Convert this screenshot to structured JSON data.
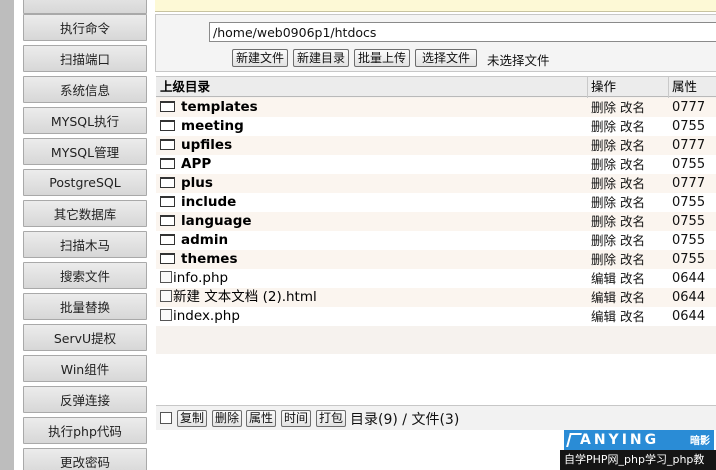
{
  "sidebar": {
    "items": [
      {
        "label": "执行命令"
      },
      {
        "label": "扫描端口"
      },
      {
        "label": "系统信息"
      },
      {
        "label": "MYSQL执行"
      },
      {
        "label": "MYSQL管理"
      },
      {
        "label": "PostgreSQL"
      },
      {
        "label": "其它数据库"
      },
      {
        "label": "扫描木马"
      },
      {
        "label": "搜索文件"
      },
      {
        "label": "批量替换"
      },
      {
        "label": "ServU提权"
      },
      {
        "label": "Win组件"
      },
      {
        "label": "反弹连接"
      },
      {
        "label": "执行php代码"
      },
      {
        "label": "更改密码"
      }
    ]
  },
  "path_bar": {
    "path": "/home/web0906p1/htdocs",
    "buttons": {
      "new_file": "新建文件",
      "new_dir": "新建目录",
      "batch_upload": "批量上传",
      "choose_file": "选择文件"
    },
    "no_file": "未选择文件"
  },
  "table": {
    "headers": {
      "name": "上级目录",
      "ops": "操作",
      "perm": "属性"
    },
    "dirs": [
      {
        "name": "templates",
        "op1": "删除",
        "op2": "改名",
        "perm": "0777"
      },
      {
        "name": "meeting",
        "op1": "删除",
        "op2": "改名",
        "perm": "0755"
      },
      {
        "name": "upfiles",
        "op1": "删除",
        "op2": "改名",
        "perm": "0777"
      },
      {
        "name": "APP",
        "op1": "删除",
        "op2": "改名",
        "perm": "0755"
      },
      {
        "name": "plus",
        "op1": "删除",
        "op2": "改名",
        "perm": "0777"
      },
      {
        "name": "include",
        "op1": "删除",
        "op2": "改名",
        "perm": "0755"
      },
      {
        "name": "language",
        "op1": "删除",
        "op2": "改名",
        "perm": "0755"
      },
      {
        "name": "admin",
        "op1": "删除",
        "op2": "改名",
        "perm": "0755"
      },
      {
        "name": "themes",
        "op1": "删除",
        "op2": "改名",
        "perm": "0755"
      }
    ],
    "files": [
      {
        "name": "info.php",
        "op1": "编辑",
        "op2": "改名",
        "perm": "0644"
      },
      {
        "name": "新建 文本文档 (2).html",
        "op1": "编辑",
        "op2": "改名",
        "perm": "0644"
      },
      {
        "name": "index.php",
        "op1": "编辑",
        "op2": "改名",
        "perm": "0644"
      }
    ]
  },
  "footer": {
    "buttons": {
      "copy": "复制",
      "delete": "删除",
      "attr": "属性",
      "time": "时间",
      "pack": "打包"
    },
    "summary": "目录(9) / 文件(3)"
  },
  "watermark": {
    "brand": "ANYING",
    "badge": "暗影",
    "text": "自学PHP网_php学习_php教"
  }
}
